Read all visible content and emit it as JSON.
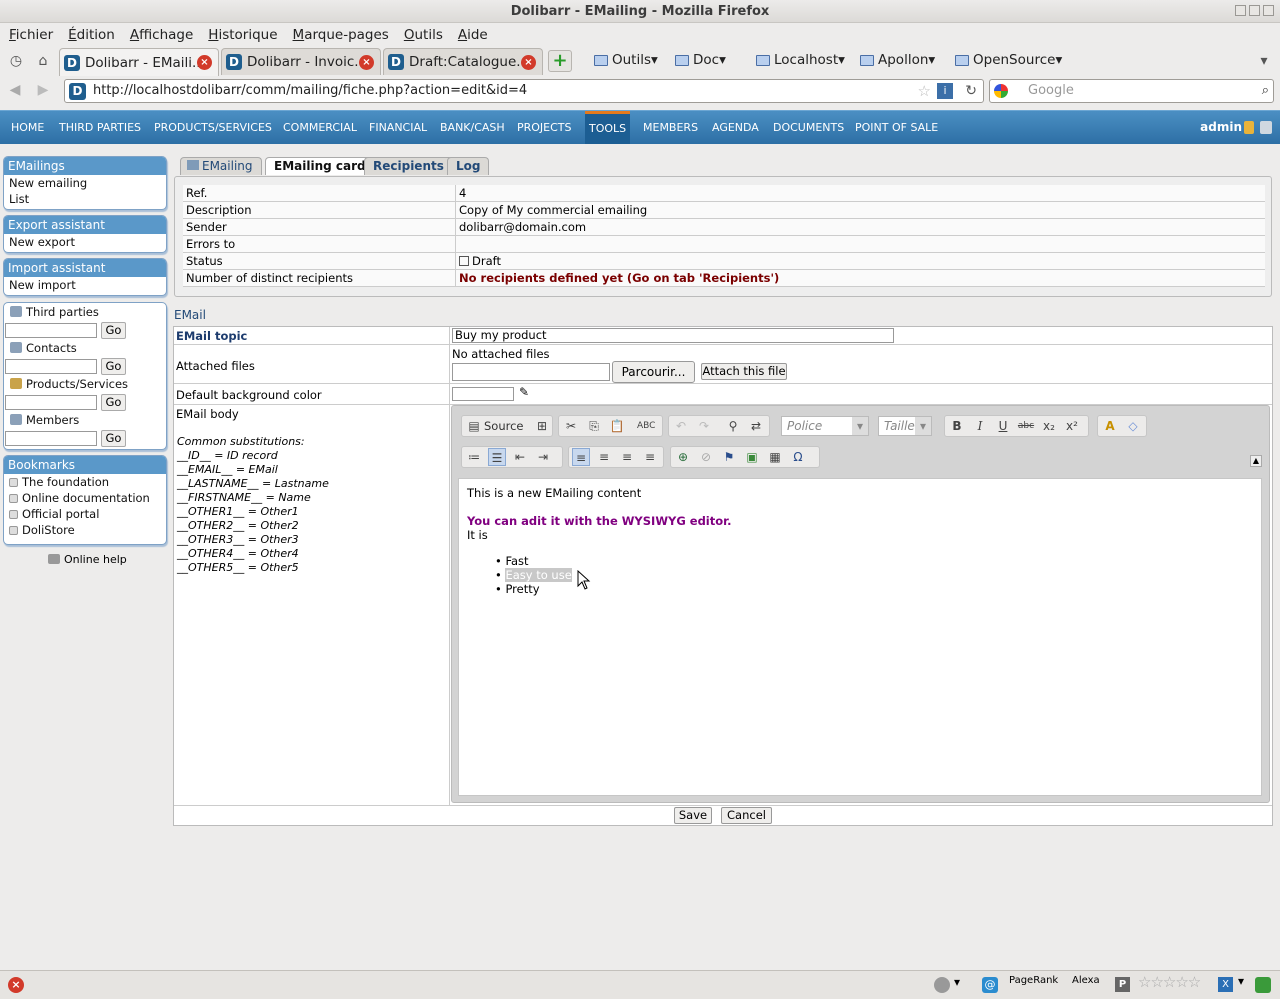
{
  "window": {
    "title": "Dolibarr - EMailing - Mozilla Firefox"
  },
  "menubar": [
    "Fichier",
    "Édition",
    "Affichage",
    "Historique",
    "Marque-pages",
    "Outils",
    "Aide"
  ],
  "browser_tabs": [
    {
      "label": "Dolibarr - EMaili..."
    },
    {
      "label": "Dolibarr - Invoic..."
    },
    {
      "label": "Draft:Catalogue..."
    }
  ],
  "bookmarks": [
    "Outils",
    "Doc",
    "Localhost",
    "Apollon",
    "OpenSource"
  ],
  "nav": {
    "url": "http://localhostdolibarr/comm/mailing/fiche.php?action=edit&id=4",
    "search_placeholder": "Google"
  },
  "topmenu": {
    "items": [
      "HOME",
      "THIRD PARTIES",
      "PRODUCTS/SERVICES",
      "COMMERCIAL",
      "FINANCIAL",
      "BANK/CASH",
      "PROJECTS",
      "TOOLS",
      "MEMBERS",
      "AGENDA",
      "DOCUMENTS",
      "POINT OF SALE"
    ],
    "user": "admin"
  },
  "leftmenu": {
    "emailings": {
      "title": "EMailings",
      "items": [
        "New emailing",
        "List"
      ]
    },
    "export": {
      "title": "Export assistant",
      "items": [
        "New export"
      ]
    },
    "import": {
      "title": "Import assistant",
      "items": [
        "New import"
      ]
    },
    "search": [
      {
        "label": "Third parties"
      },
      {
        "label": "Contacts"
      },
      {
        "label": "Products/Services"
      },
      {
        "label": "Members"
      }
    ],
    "go": "Go",
    "bookmarks": {
      "title": "Bookmarks",
      "items": [
        "The foundation",
        "Online documentation",
        "Official portal",
        "DoliStore"
      ]
    },
    "help": "Online help"
  },
  "tabs": [
    "EMailing",
    "EMailing card",
    "Recipients",
    "Log"
  ],
  "card": {
    "rows": [
      {
        "k": "Ref.",
        "v": "4"
      },
      {
        "k": "Description",
        "v": "Copy of My commercial emailing"
      },
      {
        "k": "Sender",
        "v": "dolibarr@domain.com"
      },
      {
        "k": "Errors to",
        "v": ""
      },
      {
        "k": "Status",
        "v": "Draft"
      },
      {
        "k": "Number of distinct recipients",
        "v": "No recipients defined yet (Go on tab 'Recipients')"
      }
    ]
  },
  "email": {
    "section": "EMail",
    "topic_label": "EMail topic",
    "topic_value": "Buy my product",
    "files_label": "Attached files",
    "no_files": "No attached files",
    "browse": "Parcourir...",
    "attach": "Attach this file",
    "bg_label": "Default background color",
    "body_label": "EMail body",
    "subst_title": "Common substitutions:",
    "subst": [
      "__ID__ = ID record",
      "__EMAIL__ = EMail",
      "__LASTNAME__ = Lastname",
      "__FIRSTNAME__ = Name",
      "__OTHER1__ = Other1",
      "__OTHER2__ = Other2",
      "__OTHER3__ = Other3",
      "__OTHER4__ = Other4",
      "__OTHER5__ = Other5"
    ]
  },
  "editor": {
    "source": "Source",
    "font_placeholder": "Police",
    "size_placeholder": "Taille",
    "line1": "This is a new EMailing content",
    "line2": "You can adit it with the WYSIWYG editor.",
    "line3": "It is",
    "bullets": [
      "Fast",
      "Easy to use",
      "Pretty"
    ]
  },
  "buttons": {
    "save": "Save",
    "cancel": "Cancel"
  },
  "statusbar": {
    "pagerank": "PageRank",
    "alexa": "Alexa"
  }
}
